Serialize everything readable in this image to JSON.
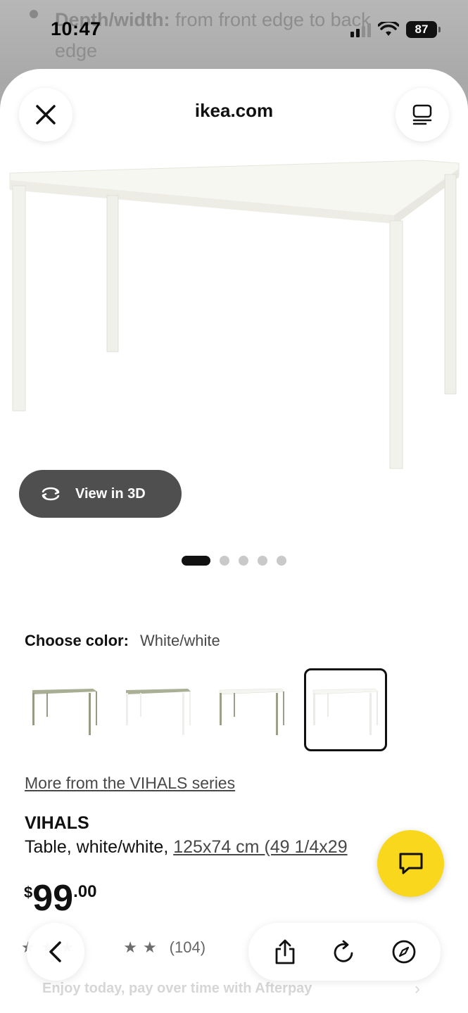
{
  "background": {
    "bullet_bold": "Depth/width:",
    "bullet_text": " from front edge to back edge"
  },
  "status_bar": {
    "time": "10:47",
    "battery": "87"
  },
  "header": {
    "site": "ikea.com"
  },
  "product_image": {
    "view_3d_label": "View in 3D",
    "page_count": 5,
    "active_page": 1
  },
  "color": {
    "label": "Choose color:",
    "value": "White/white",
    "swatch_count": 4,
    "selected_index": 4
  },
  "series_link": "More from the VIHALS series",
  "product": {
    "name": "VIHALS",
    "desc_prefix": "Table, white/white, ",
    "dimensions": "125x74 cm (49 1/4x29",
    "price_currency": "$",
    "price_main": "99",
    "price_decimal": ".00",
    "review_count": "(104)"
  },
  "afterpay": "Enjoy today, pay over time with Afterpay",
  "colors": {
    "accent_yellow": "#f9d71c",
    "dark_button": "#4f4f4f"
  }
}
